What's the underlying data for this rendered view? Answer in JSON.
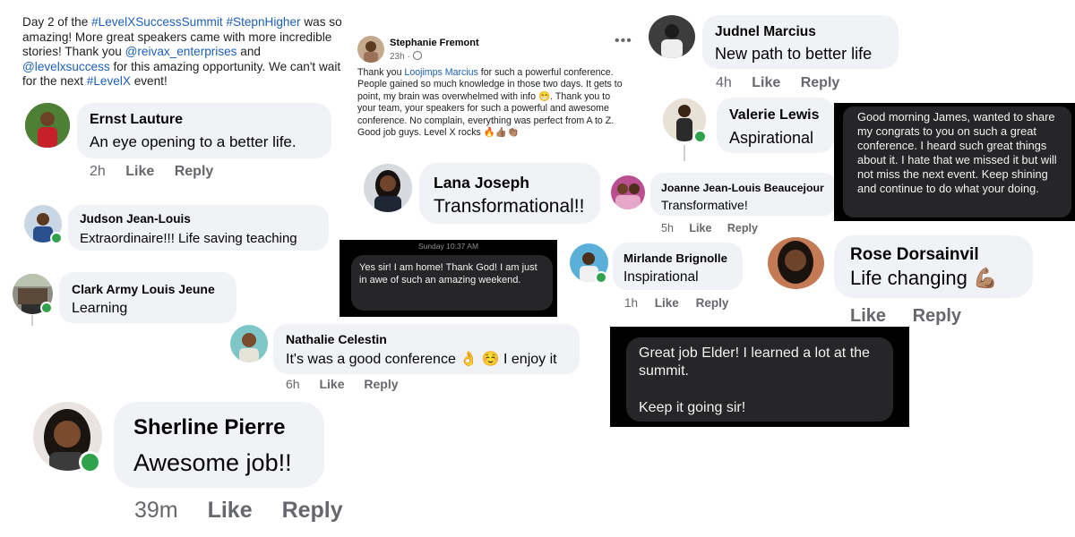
{
  "post_top_left": {
    "p1": "Day 2 of the ",
    "tag1": "#LevelXSuccessSummit",
    "tag2": "#StepnHigher",
    "p2": " was so amazing!  More great speakers came with more incredible stories!  Thank you ",
    "mention1": "@reivax_enterprises",
    "p3": " and ",
    "mention2": "@levelxsuccess",
    "p4": " for this amazing opportunity.  We can't wait for the next ",
    "tag3": "#LevelX",
    "p5": " event!"
  },
  "post_center": {
    "author": "Stephanie Fremont",
    "time": "23h · ",
    "globe_icon": "globe-icon",
    "more_icon": "more-options-icon",
    "p1": "Thank you ",
    "mention": "Loojimps Marcius",
    "p2": " for such a powerful conference. People gained so much knowledge in those two days. It gets to point, my brain was overwhelmed with info 😁. Thank you to your team, your speakers for such a powerful and awesome conference. No complain, everything was perfect from A to Z. Good job guys. Level X rocks 🔥👍🏽👏🏽"
  },
  "comments": {
    "ernst": {
      "name": "Ernst Lauture",
      "text": "An eye opening to a better life.",
      "time": "2h",
      "like": "Like",
      "reply": "Reply"
    },
    "judson": {
      "name": "Judson Jean-Louis",
      "text": "Extraordinaire!!! Life saving teaching"
    },
    "clark": {
      "name": "Clark Army Louis Jeune",
      "text": "Learning"
    },
    "nathalie": {
      "name": "Nathalie Celestin",
      "text": "It's was a good conference 👌 ☺️ I enjoy it",
      "time": "6h",
      "like": "Like",
      "reply": "Reply"
    },
    "sherline": {
      "name": "Sherline Pierre",
      "text": "Awesome job!!",
      "time": "39m",
      "like": "Like",
      "reply": "Reply"
    },
    "lana": {
      "name": "Lana Joseph",
      "text": "Transformational!!"
    },
    "judnel": {
      "name": "Judnel Marcius",
      "text": "New path to better life",
      "time": "4h",
      "like": "Like",
      "reply": "Reply"
    },
    "valerie": {
      "name": "Valerie Lewis",
      "text": "Aspirational"
    },
    "joanne": {
      "name": "Joanne Jean-Louis Beaucejour",
      "text": "Transformative!",
      "time": "5h",
      "like": "Like",
      "reply": "Reply"
    },
    "mirlande": {
      "name": "Mirlande Brignolle",
      "text": "Inspirational",
      "time": "1h",
      "like": "Like",
      "reply": "Reply"
    },
    "rose": {
      "name": "Rose Dorsainvil",
      "text": "Life changing 💪🏽",
      "like": "Like",
      "reply": "Reply"
    }
  },
  "messages": {
    "sms1_timestamp": "Sunday 10:37 AM",
    "sms1_text": "Yes sir!  I am home!  Thank God!  I am just in awe of such an amazing weekend.",
    "sms2_text": "Good morning James, wanted to share my congrats to you on such a great conference. I heard such great things about it. I hate that we missed it but will not miss the next event. Keep shining and continue to do what your doing.",
    "sms3_line1": "Great job Elder! I learned a lot at the summit.",
    "sms3_line2": "Keep it going sir!"
  },
  "colors": {
    "link_blue": "#1d5fb8",
    "bubble_gray": "#f0f2f5",
    "online_green": "#31a24c",
    "sms_background": "#000000",
    "sms_bubble": "#262628"
  }
}
